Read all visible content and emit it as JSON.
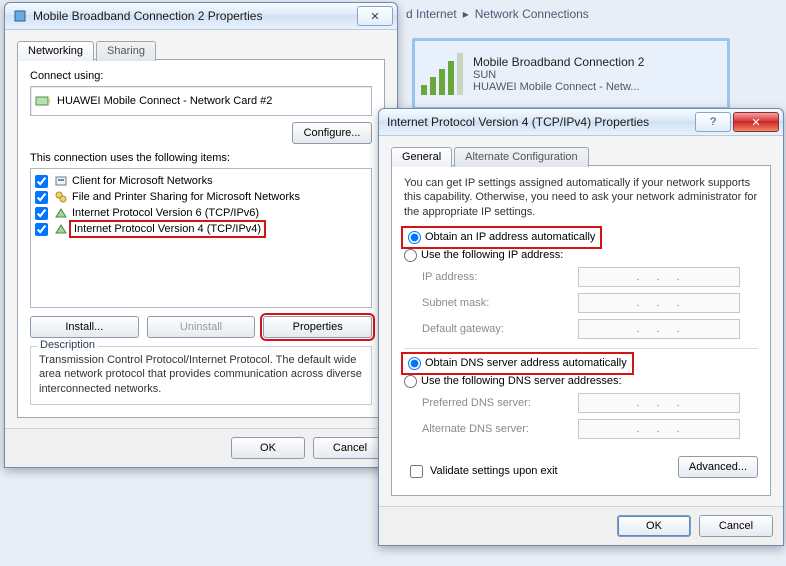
{
  "explorer": {
    "crumb1": "d Internet",
    "sep": "▸",
    "crumb2": "Network Connections"
  },
  "connCard": {
    "name": "Mobile Broadband Connection 2",
    "line2": "SUN",
    "line3": "HUAWEI Mobile Connect - Netw..."
  },
  "propWin": {
    "title": "Mobile Broadband Connection 2 Properties",
    "tabs": {
      "networking": "Networking",
      "sharing": "Sharing"
    },
    "connectUsing": "Connect using:",
    "adapter": "HUAWEI Mobile Connect - Network Card #2",
    "configure": "Configure...",
    "itemsLabel": "This connection uses the following items:",
    "items": [
      {
        "label": "Client for Microsoft Networks"
      },
      {
        "label": "File and Printer Sharing for Microsoft Networks"
      },
      {
        "label": "Internet Protocol Version 6 (TCP/IPv6)"
      },
      {
        "label": "Internet Protocol Version 4 (TCP/IPv4)"
      }
    ],
    "install": "Install...",
    "uninstall": "Uninstall",
    "properties": "Properties",
    "descLabel": "Description",
    "descText": "Transmission Control Protocol/Internet Protocol. The default wide area network protocol that provides communication across diverse interconnected networks.",
    "ok": "OK",
    "cancel": "Cancel"
  },
  "ipv4Win": {
    "title": "Internet Protocol Version 4 (TCP/IPv4) Properties",
    "tabs": {
      "general": "General",
      "alt": "Alternate Configuration"
    },
    "intro": "You can get IP settings assigned automatically if your network supports this capability. Otherwise, you need to ask your network administrator for the appropriate IP settings.",
    "optAutoIP": "Obtain an IP address automatically",
    "optManualIP": "Use the following IP address:",
    "ipAddr": "IP address:",
    "subnet": "Subnet mask:",
    "gateway": "Default gateway:",
    "optAutoDNS": "Obtain DNS server address automatically",
    "optManualDNS": "Use the following DNS server addresses:",
    "prefDNS": "Preferred DNS server:",
    "altDNS": "Alternate DNS server:",
    "validate": "Validate settings upon exit",
    "advanced": "Advanced...",
    "ok": "OK",
    "cancel": "Cancel"
  }
}
